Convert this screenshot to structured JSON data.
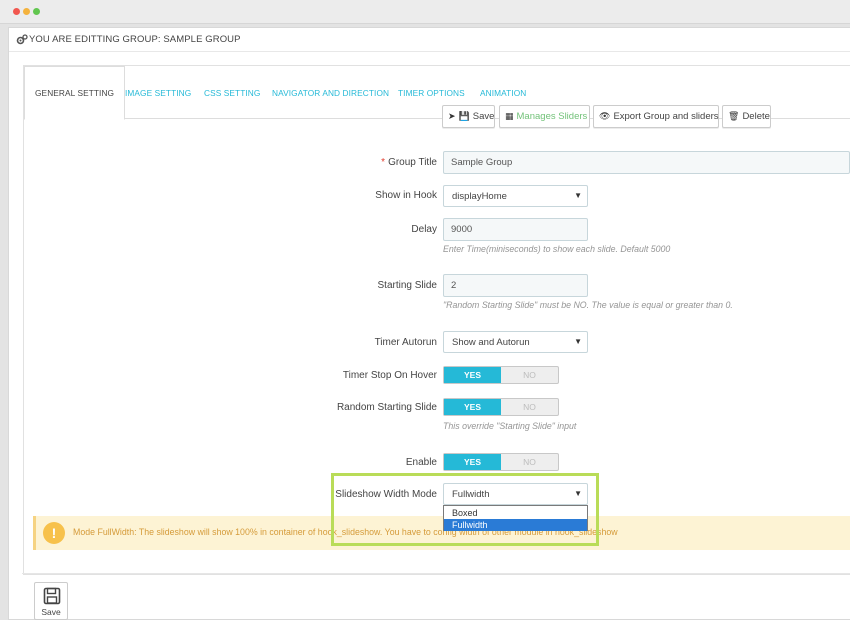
{
  "window": {
    "dot_colors": [
      "#f1574f",
      "#f4b23d",
      "#61c64f"
    ]
  },
  "panel": {
    "title": "YOU ARE EDITTING GROUP: SAMPLE GROUP",
    "icon": "cogs-icon"
  },
  "tabs": [
    {
      "label": "GENERAL SETTING",
      "active": true
    },
    {
      "label": "IMAGE SETTING"
    },
    {
      "label": "CSS SETTING"
    },
    {
      "label": "NAVIGATOR AND DIRECTION"
    },
    {
      "label": "TIMER OPTIONS"
    },
    {
      "label": "ANIMATION"
    }
  ],
  "toolbar": {
    "save": "Save",
    "manage": "Manages Sliders",
    "export": "Export Group and sliders",
    "delete": "Delete"
  },
  "form": {
    "group_title": {
      "label": "Group Title",
      "required_mark": "*",
      "value": "Sample Group"
    },
    "show_in_hook": {
      "label": "Show in Hook",
      "value": "displayHome"
    },
    "delay": {
      "label": "Delay",
      "value": "9000",
      "help": "Enter Time(miniseconds) to show each slide. Default 5000"
    },
    "starting_slide": {
      "label": "Starting Slide",
      "value": "2",
      "help": "\"Random Starting Slide\" must be NO. The value is equal or greater than 0."
    },
    "timer_autorun": {
      "label": "Timer Autorun",
      "value": "Show and Autorun"
    },
    "timer_stop_on_hover": {
      "label": "Timer Stop On Hover",
      "yes": "YES",
      "no": "NO",
      "value": "YES"
    },
    "random_starting_slide": {
      "label": "Random Starting Slide",
      "yes": "YES",
      "no": "NO",
      "value": "YES",
      "help": "This override \"Starting Slide\" input"
    },
    "enable": {
      "label": "Enable",
      "yes": "YES",
      "no": "NO",
      "value": "YES"
    },
    "width_mode": {
      "label": "Slideshow Width Mode",
      "value": "Fullwidth",
      "options": [
        "Boxed",
        "Fullwidth"
      ]
    }
  },
  "alert": {
    "text": "Mode FullWidth: The slideshow will show 100% in container of hook_slideshow. You have to config width of other module in hook_slideshow"
  },
  "footer": {
    "save": "Save"
  },
  "colors": {
    "accent": "#25b9d7",
    "highlight_border": "#b9dc58",
    "warning": "#f7c14b",
    "required": "#e13d2e"
  }
}
